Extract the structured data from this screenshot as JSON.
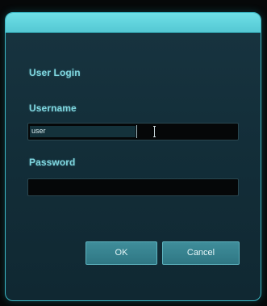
{
  "dialog": {
    "heading": "User Login",
    "username": {
      "label": "Username",
      "value": "user"
    },
    "password": {
      "label": "Password",
      "value": ""
    },
    "buttons": {
      "ok_label": "OK",
      "cancel_label": "Cancel"
    },
    "colors": {
      "accent": "#5fd3dc",
      "panel": "#153140",
      "field_bg": "#050708",
      "button": "#3a8794",
      "label_text": "#7fd6df"
    },
    "icons": {
      "text_cursor": "text-cursor-icon"
    }
  }
}
